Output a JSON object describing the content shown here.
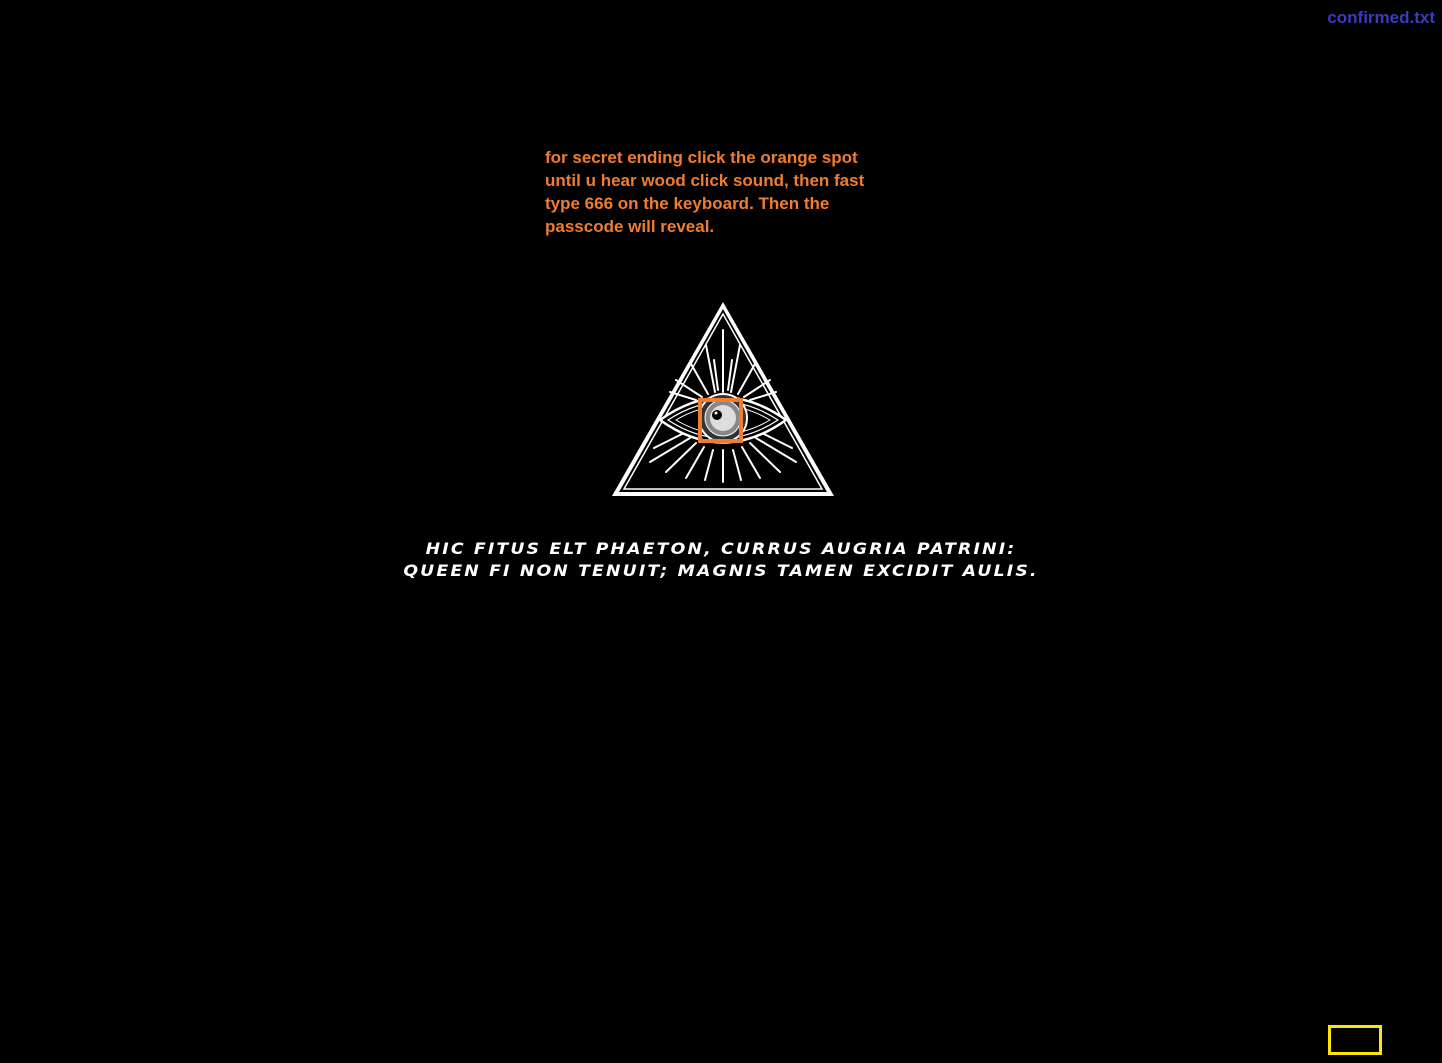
{
  "header": {
    "file_link": "confirmed.txt"
  },
  "instructions": {
    "line1": "for secret ending click the orange spot",
    "line2": "until u hear wood click sound, then fast",
    "line3": "type 666 on the keyboard. Then the",
    "line4": "passcode will reveal."
  },
  "quote": {
    "line1": "Hic fitus elt Phaeton, currus augria patrini:",
    "line2": "queen fi non tenuit; magnis tamen excidit aulis."
  },
  "colors": {
    "background": "#000000",
    "link": "#3b3bbd",
    "instructions": "#f07d2e",
    "orange_spot": "#f07d2e",
    "quote": "#ffffff",
    "yellow_box": "#ffe600"
  },
  "icons": {
    "pyramid": "all-seeing-eye-pyramid-icon"
  }
}
